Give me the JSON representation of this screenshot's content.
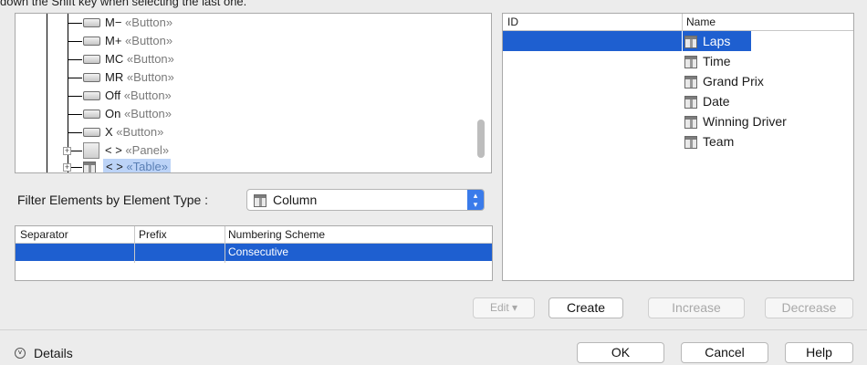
{
  "instruction_text": "down the Shift key when selecting the last one.",
  "tree": {
    "items": [
      {
        "name": "M−",
        "stereotype": "«Button»",
        "icon": "button-icon"
      },
      {
        "name": "M+",
        "stereotype": "«Button»",
        "icon": "button-icon"
      },
      {
        "name": "MC",
        "stereotype": "«Button»",
        "icon": "button-icon"
      },
      {
        "name": "MR",
        "stereotype": "«Button»",
        "icon": "button-icon"
      },
      {
        "name": "Off",
        "stereotype": "«Button»",
        "icon": "button-icon"
      },
      {
        "name": "On",
        "stereotype": "«Button»",
        "icon": "button-icon"
      },
      {
        "name": "X",
        "stereotype": "«Button»",
        "icon": "button-icon"
      },
      {
        "name": "< >",
        "stereotype": "«Panel»",
        "icon": "panel-icon"
      },
      {
        "name": "< >",
        "stereotype": "«Table»",
        "icon": "table-icon",
        "selected": true
      }
    ]
  },
  "filter": {
    "label": "Filter Elements by Element Type :",
    "selected_value": "Column",
    "icon": "column-icon"
  },
  "numbering_table": {
    "columns": [
      "Separator",
      "Prefix",
      "Numbering Scheme"
    ],
    "rows": [
      {
        "separator": "",
        "prefix": "",
        "numbering_scheme": "Consecutive"
      }
    ]
  },
  "elements_table": {
    "columns": [
      "ID",
      "Name"
    ],
    "rows": [
      {
        "id": "",
        "name": "Laps"
      },
      {
        "id": "",
        "name": "Time"
      },
      {
        "id": "",
        "name": "Grand Prix"
      },
      {
        "id": "",
        "name": "Date"
      },
      {
        "id": "",
        "name": "Winning Driver"
      },
      {
        "id": "",
        "name": "Team"
      }
    ]
  },
  "actions": {
    "edit": "Edit ▾",
    "create": "Create",
    "increase": "Increase",
    "decrease": "Decrease"
  },
  "footer": {
    "details": "Details",
    "ok": "OK",
    "cancel": "Cancel",
    "help": "Help"
  },
  "colors": {
    "selection": "#1e5fd0",
    "tree_selection": "#bcd3f7",
    "select_arrow": "#3a7bea"
  }
}
